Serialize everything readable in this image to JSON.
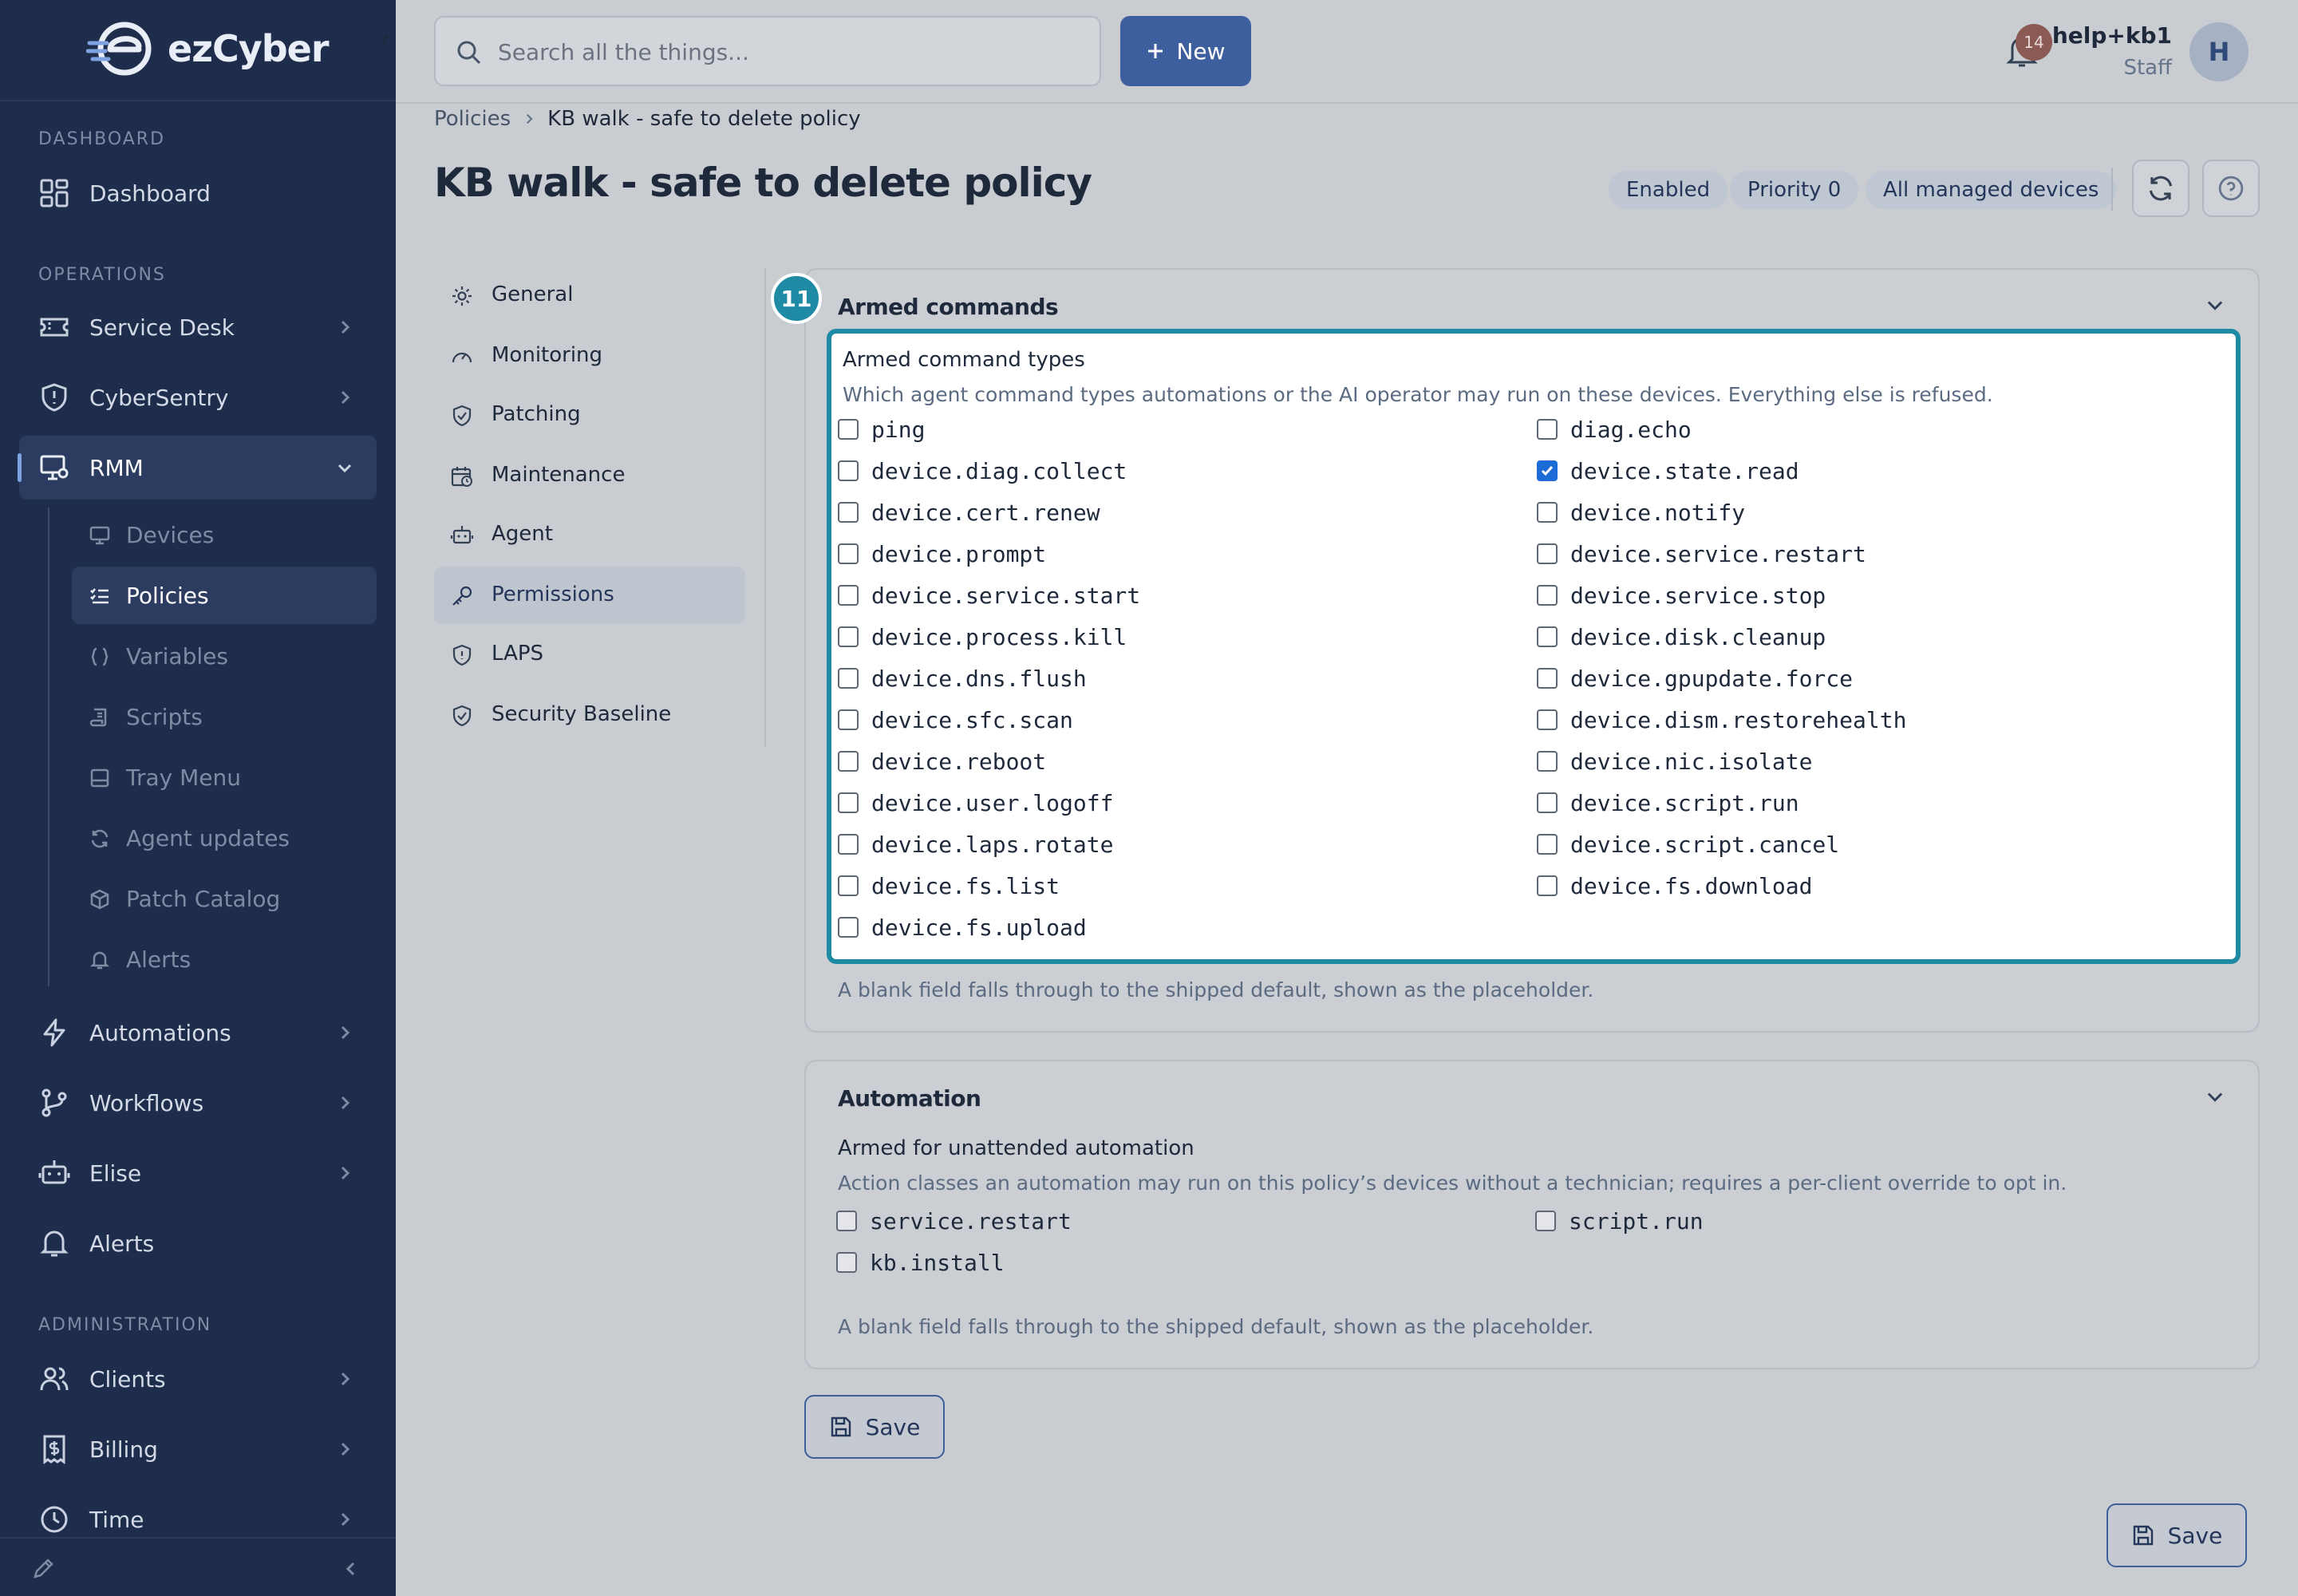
{
  "app": {
    "logo_text": "ezCyber"
  },
  "sidebar": {
    "sections": {
      "dashboard": "DASHBOARD",
      "operations": "OPERATIONS",
      "administration": "ADMINISTRATION"
    },
    "items": {
      "dashboard": "Dashboard",
      "service_desk": "Service Desk",
      "cybersentry": "CyberSentry",
      "rmm": "RMM",
      "automations": "Automations",
      "workflows": "Workflows",
      "elise": "Elise",
      "alerts": "Alerts",
      "clients": "Clients",
      "billing": "Billing",
      "time": "Time"
    },
    "rmm_sub": {
      "devices": "Devices",
      "policies": "Policies",
      "variables": "Variables",
      "scripts": "Scripts",
      "tray_menu": "Tray Menu",
      "agent_updates": "Agent updates",
      "patch_catalog": "Patch Catalog",
      "alerts": "Alerts"
    },
    "active_item": "Policies"
  },
  "topbar": {
    "search_placeholder": "Search all the things...",
    "new_label": "New",
    "notification_count": "14",
    "user_name": "help+kb1",
    "user_role": "Staff",
    "avatar_initial": "H"
  },
  "header": {
    "breadcrumb_root": "Policies",
    "breadcrumb_current": "KB walk - safe to delete policy",
    "title": "KB walk - safe to delete policy",
    "badges": {
      "enabled": "Enabled",
      "priority": "Priority 0",
      "scope": "All managed devices"
    }
  },
  "policy_nav": {
    "general": "General",
    "monitoring": "Monitoring",
    "patching": "Patching",
    "maintenance": "Maintenance",
    "agent": "Agent",
    "permissions": "Permissions",
    "laps": "LAPS",
    "security_baseline": "Security Baseline"
  },
  "armed_commands": {
    "title": "Armed commands",
    "step_number": "11",
    "field_label": "Armed command types",
    "field_desc": "Which agent command types automations or the AI operator may run on these devices. Everything else is refused.",
    "hint": "A blank field falls through to the shipped default, shown as the placeholder.",
    "options": [
      {
        "label": "ping",
        "checked": false
      },
      {
        "label": "diag.echo",
        "checked": false
      },
      {
        "label": "device.diag.collect",
        "checked": false
      },
      {
        "label": "device.state.read",
        "checked": true
      },
      {
        "label": "device.cert.renew",
        "checked": false
      },
      {
        "label": "device.notify",
        "checked": false
      },
      {
        "label": "device.prompt",
        "checked": false
      },
      {
        "label": "device.service.restart",
        "checked": false
      },
      {
        "label": "device.service.start",
        "checked": false
      },
      {
        "label": "device.service.stop",
        "checked": false
      },
      {
        "label": "device.process.kill",
        "checked": false
      },
      {
        "label": "device.disk.cleanup",
        "checked": false
      },
      {
        "label": "device.dns.flush",
        "checked": false
      },
      {
        "label": "device.gpupdate.force",
        "checked": false
      },
      {
        "label": "device.sfc.scan",
        "checked": false
      },
      {
        "label": "device.dism.restorehealth",
        "checked": false
      },
      {
        "label": "device.reboot",
        "checked": false
      },
      {
        "label": "device.nic.isolate",
        "checked": false
      },
      {
        "label": "device.user.logoff",
        "checked": false
      },
      {
        "label": "device.script.run",
        "checked": false
      },
      {
        "label": "device.laps.rotate",
        "checked": false
      },
      {
        "label": "device.script.cancel",
        "checked": false
      },
      {
        "label": "device.fs.list",
        "checked": false
      },
      {
        "label": "device.fs.download",
        "checked": false
      },
      {
        "label": "device.fs.upload",
        "checked": false
      }
    ]
  },
  "automation": {
    "title": "Automation",
    "field_label": "Armed for unattended automation",
    "field_desc": "Action classes an automation may run on this policy’s devices without a technician; requires a per-client override to opt in.",
    "hint": "A blank field falls through to the shipped default, shown as the placeholder.",
    "options": [
      {
        "label": "service.restart",
        "checked": false
      },
      {
        "label": "script.run",
        "checked": false
      },
      {
        "label": "kb.install",
        "checked": false
      }
    ]
  },
  "actions": {
    "save_label": "Save",
    "save_bottom_label": "Save"
  },
  "colors": {
    "sidebar_bg": "#1f2d4d",
    "accent": "#3e5f9e",
    "highlight": "#1f8aa3",
    "checked": "#1d6bd6"
  }
}
